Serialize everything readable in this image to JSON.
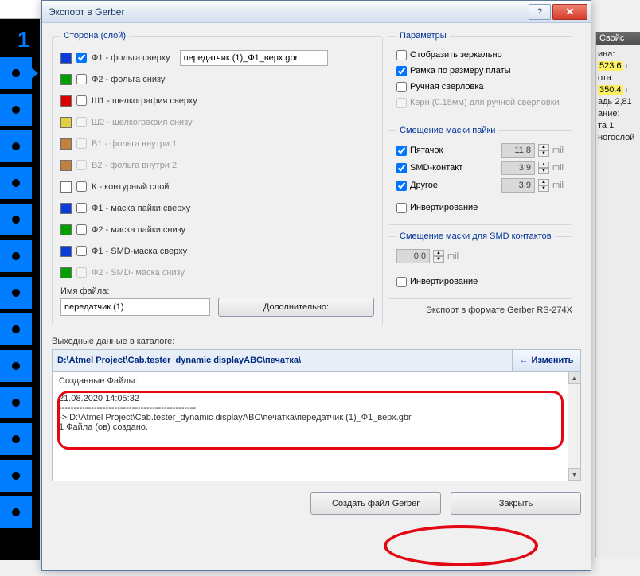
{
  "bg": {
    "number": "1"
  },
  "titlebar": {
    "title": "Экспорт в Gerber",
    "help": "?",
    "close": "✕"
  },
  "side": {
    "legend": "Сторона (слой)",
    "layers": [
      {
        "color": "#0b3bd8",
        "checked": true,
        "label": "Ф1 - фольга сверху",
        "disabled": false,
        "file": "передатчик (1)_Ф1_верх.gbr"
      },
      {
        "color": "#00a000",
        "checked": false,
        "label": "Ф2 - фольга снизу",
        "disabled": false
      },
      {
        "color": "#d80000",
        "checked": false,
        "label": "Ш1 - шелкография сверху",
        "disabled": false
      },
      {
        "color": "#e0d040",
        "checked": false,
        "label": "Ш2 - шелкография снизу",
        "disabled": true
      },
      {
        "color": "#c08040",
        "checked": false,
        "label": "В1 - фольга внутри 1",
        "disabled": true
      },
      {
        "color": "#c08040",
        "checked": false,
        "label": "В2 - фольга внутри 2",
        "disabled": true
      },
      {
        "color": "#ffffff",
        "checked": false,
        "label": "К - контурный слой",
        "disabled": false
      },
      {
        "color": "#0b3bd8",
        "checked": false,
        "label": "Ф1 - маска пайки сверху",
        "disabled": false
      },
      {
        "color": "#00a000",
        "checked": false,
        "label": "Ф2 - маска пайки снизу",
        "disabled": false
      },
      {
        "color": "#0b3bd8",
        "checked": false,
        "label": "Ф1 - SMD-маска сверху",
        "disabled": false
      },
      {
        "color": "#00a000",
        "checked": false,
        "label": "Ф2 - SMD- маска снизу",
        "disabled": true
      }
    ],
    "filename_label": "Имя файла:",
    "filename_value": "передатчик (1)",
    "more_btn": "Дополнительно:"
  },
  "params": {
    "legend": "Параметры",
    "mirror": {
      "checked": false,
      "label": "Отобразить зеркально"
    },
    "frame": {
      "checked": true,
      "label": "Рамка по размеру платы"
    },
    "manual": {
      "checked": false,
      "label": "Ручная сверловка"
    },
    "kern": {
      "checked": false,
      "label": "Керн (0.15мм) для ручной сверловки",
      "disabled": true
    }
  },
  "mask": {
    "legend": "Смещение маски пайки",
    "pad": {
      "checked": true,
      "label": "Пятачок",
      "value": "11.8",
      "unit": "mil"
    },
    "smd": {
      "checked": true,
      "label": "SMD-контакт",
      "value": "3.9",
      "unit": "mil"
    },
    "other": {
      "checked": true,
      "label": "Другое",
      "value": "3.9",
      "unit": "mil"
    },
    "invert": {
      "checked": false,
      "label": "Инвертирование"
    }
  },
  "smdmask": {
    "legend": "Смещение маски для SMD контактов",
    "value": "0.0",
    "unit": "mil",
    "invert": {
      "checked": false,
      "label": "Инвертирование"
    }
  },
  "export_note": "Экспорт в формате Gerber RS-274X",
  "output": {
    "label": "Выходные данные в каталоге:",
    "path": "D:\\Atmel Project\\Cab.tester_dynamic displayABC\\печатка\\",
    "change": "Изменить",
    "log_header": "Созданные Файлы:",
    "timestamp": "21.08.2020 14:05:32",
    "sep": "-----------------------------------------------",
    "line1": "-> D:\\Atmel Project\\Cab.tester_dynamic displayABC\\печатка\\передатчик (1)_Ф1_верх.gbr",
    "line2": "1 Файла (ов) создано."
  },
  "buttons": {
    "create": "Создать файл Gerber",
    "close": "Закрыть"
  },
  "props": {
    "header": "Свойс",
    "rows": {
      "a": "ина:",
      "av": "523.6",
      "au": "г",
      "b": "ота:",
      "bv": "350.4",
      "bu": "г",
      "c": "адь",
      "cv": "2,81",
      "d": "ание:",
      "e": "та 1",
      "f": "ногослой"
    }
  }
}
